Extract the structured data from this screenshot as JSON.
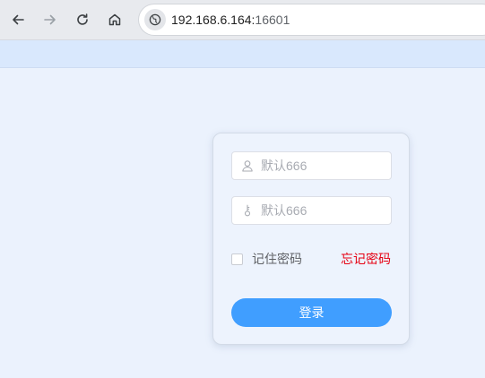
{
  "browser": {
    "url_host": "192.168.6.164:",
    "url_port": "16601",
    "icons": [
      "back-icon",
      "forward-icon",
      "reload-icon",
      "home-icon",
      "site-info-icon"
    ]
  },
  "login": {
    "username_placeholder": "默认666",
    "password_placeholder": "默认666",
    "remember_label": "记住密码",
    "remember_checked": false,
    "forgot_label": "忘记密码",
    "submit_label": "登录"
  },
  "colors": {
    "page_background": "#ebf2fd",
    "strip_background": "#d9e8fd",
    "primary_button": "#409eff",
    "forgot_link": "#e60012"
  }
}
